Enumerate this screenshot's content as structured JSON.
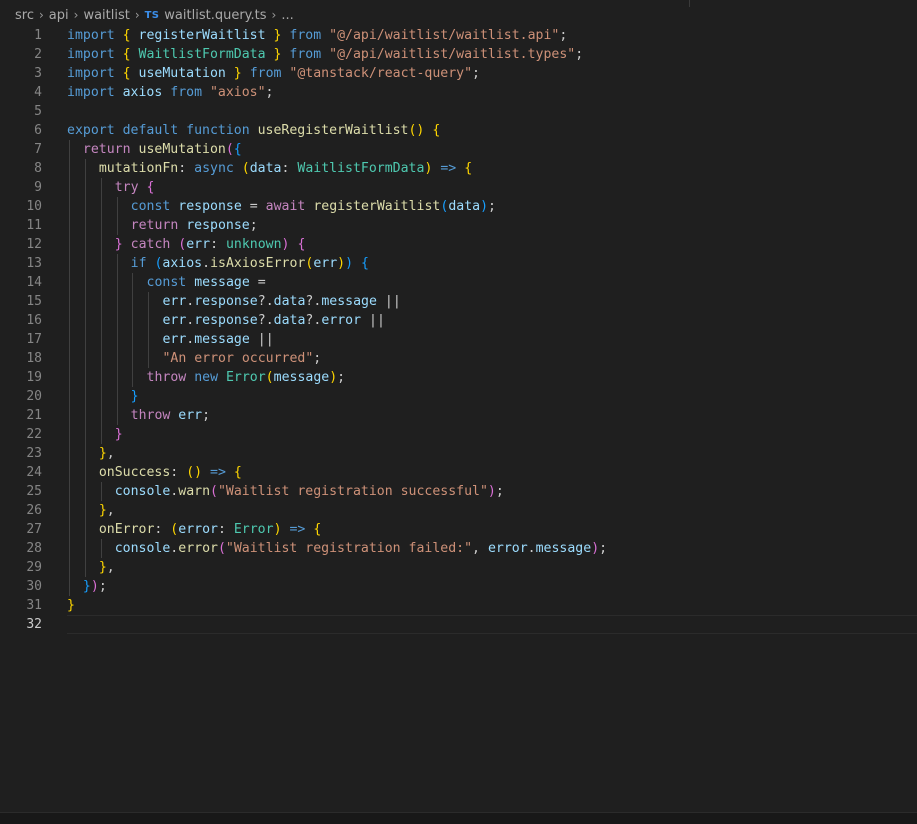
{
  "breadcrumb": {
    "items": [
      "src",
      "api",
      "waitlist"
    ],
    "file_badge": "TS",
    "file_name": "waitlist.query.ts",
    "more": "..."
  },
  "editor": {
    "language": "typescript",
    "active_line": 32,
    "line_count": 32,
    "lines": [
      "import { registerWaitlist } from \"@/api/waitlist/waitlist.api\";",
      "import { WaitlistFormData } from \"@/api/waitlist/waitlist.types\";",
      "import { useMutation } from \"@tanstack/react-query\";",
      "import axios from \"axios\";",
      "",
      "export default function useRegisterWaitlist() {",
      "  return useMutation({",
      "    mutationFn: async (data: WaitlistFormData) => {",
      "      try {",
      "        const response = await registerWaitlist(data);",
      "        return response;",
      "      } catch (err: unknown) {",
      "        if (axios.isAxiosError(err)) {",
      "          const message =",
      "            err.response?.data?.message ||",
      "            err.response?.data?.error ||",
      "            err.message ||",
      "            \"An error occurred\";",
      "          throw new Error(message);",
      "        }",
      "        throw err;",
      "      }",
      "    },",
      "    onSuccess: () => {",
      "      console.warn(\"Waitlist registration successful\");",
      "    },",
      "    onError: (error: Error) => {",
      "      console.error(\"Waitlist registration failed:\", error.message);",
      "    },",
      "  });",
      "}",
      ""
    ]
  },
  "colors": {
    "background": "#1f1f1f",
    "keyword": "#569cd6",
    "control": "#c586c0",
    "function": "#dcdcaa",
    "variable": "#9cdcfe",
    "string": "#ce9178",
    "type": "#4ec9b0",
    "bracket_level1": "#ffd700",
    "bracket_level2": "#da70d6",
    "bracket_level3": "#179fff"
  }
}
